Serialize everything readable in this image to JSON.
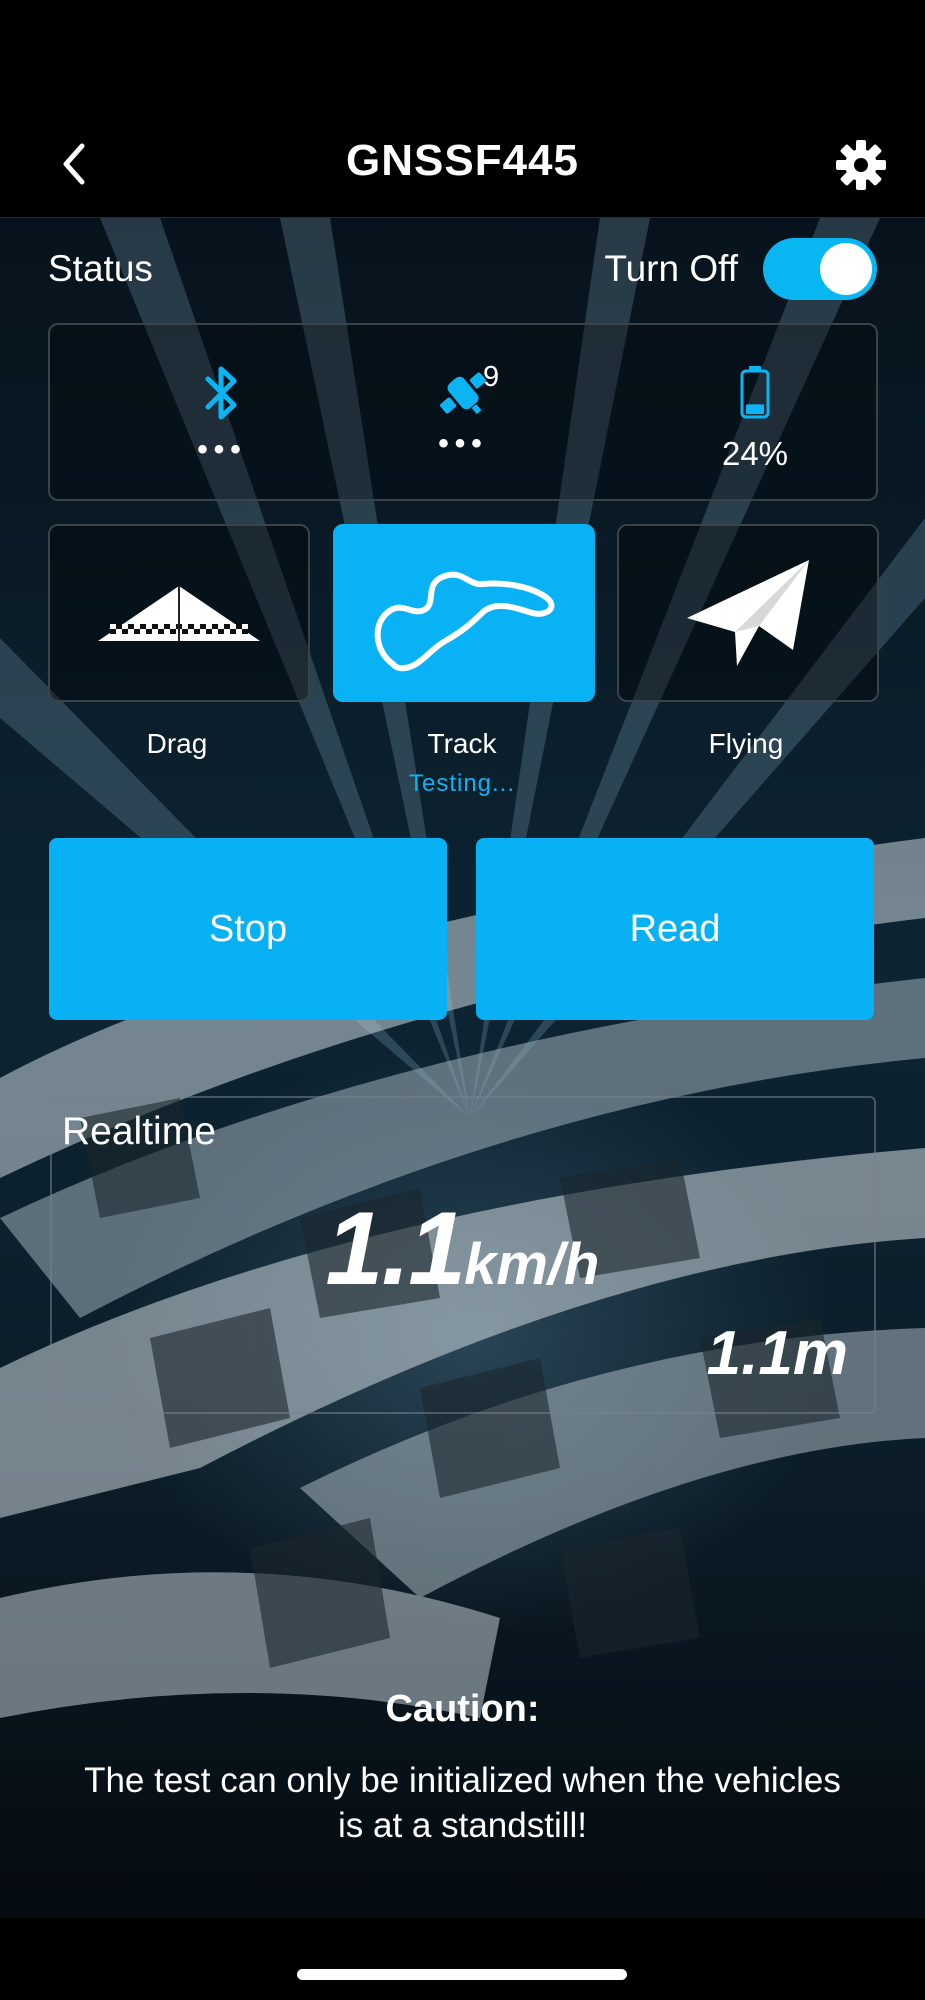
{
  "header": {
    "title": "GNSSF445",
    "back_icon": "chevron-left-icon",
    "settings_icon": "gear-icon"
  },
  "status": {
    "label": "Status",
    "toggle_label": "Turn Off",
    "toggle_on": true,
    "bluetooth": {
      "icon": "bluetooth-icon",
      "value": "•••"
    },
    "satellite": {
      "icon": "satellite-icon",
      "count": "9",
      "value": "•••"
    },
    "battery": {
      "icon": "battery-icon",
      "percent": "24%",
      "level": 0.24
    }
  },
  "modes": [
    {
      "label": "Drag",
      "icon": "drag-strip-icon",
      "active": false,
      "sub": ""
    },
    {
      "label": "Track",
      "icon": "race-track-icon",
      "active": true,
      "sub": "Testing..."
    },
    {
      "label": "Flying",
      "icon": "paper-plane-icon",
      "active": false,
      "sub": ""
    }
  ],
  "actions": {
    "stop_label": "Stop",
    "read_label": "Read"
  },
  "realtime": {
    "label": "Realtime",
    "speed": "1.1",
    "speed_unit": "km/h",
    "distance": "1.1m"
  },
  "caution": {
    "title": "Caution:",
    "text": "The test can only be initialized when the vehicles is at a standstill!"
  },
  "colors": {
    "accent": "#09b2f4",
    "background": "#000000",
    "text": "#ffffff"
  }
}
